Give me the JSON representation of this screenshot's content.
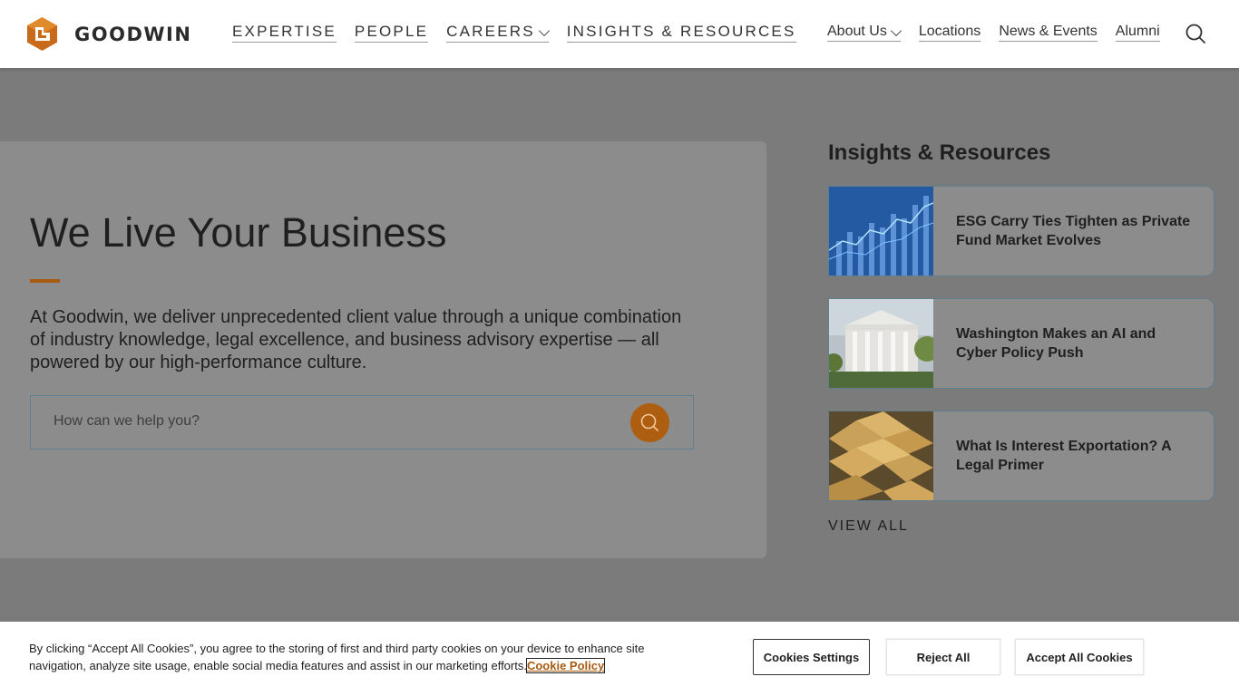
{
  "header": {
    "logo_text": "GOODWIN",
    "main_nav": [
      {
        "label": "EXPERTISE",
        "has_dropdown": false
      },
      {
        "label": "PEOPLE",
        "has_dropdown": false
      },
      {
        "label": "CAREERS",
        "has_dropdown": true
      },
      {
        "label": "INSIGHTS & RESOURCES",
        "has_dropdown": false
      }
    ],
    "secondary_nav": [
      {
        "label": "About Us",
        "has_dropdown": true
      },
      {
        "label": "Locations",
        "has_dropdown": false
      },
      {
        "label": "News & Events",
        "has_dropdown": false
      },
      {
        "label": "Alumni",
        "has_dropdown": false
      }
    ]
  },
  "hero": {
    "title": "We Live Your Business",
    "text": "At Goodwin, we deliver unprecedented client value through a unique combination of industry knowledge, legal excellence, and business advisory expertise — all powered by our high-performance culture.",
    "search_placeholder": "How can we help you?"
  },
  "insights": {
    "title": "Insights & Resources",
    "cards": [
      {
        "title": "ESG Carry Ties Tighten as Private Fund Market Evolves",
        "image": "financial-chart-image"
      },
      {
        "title": "Washington Makes an AI and Cyber Policy Push",
        "image": "white-house-image"
      },
      {
        "title": "What Is Interest Exportation? A Legal Primer",
        "image": "gold-bars-image"
      }
    ],
    "view_all": "VIEW ALL"
  },
  "cookie": {
    "text": "By clicking “Accept All Cookies”, you agree to the storing of first and third party cookies on your device to enhance site navigation, analyze site usage, enable social media features and assist in our marketing efforts.",
    "policy_link": "Cookie Policy",
    "settings_label": "Cookies Settings",
    "reject_label": "Reject All",
    "accept_label": "Accept All Cookies"
  },
  "colors": {
    "brand_orange": "#ae5e10",
    "overlay_bg": "#7b7b7b",
    "panel_bg": "#8c8c8c",
    "card_border": "#5f7f8f"
  }
}
